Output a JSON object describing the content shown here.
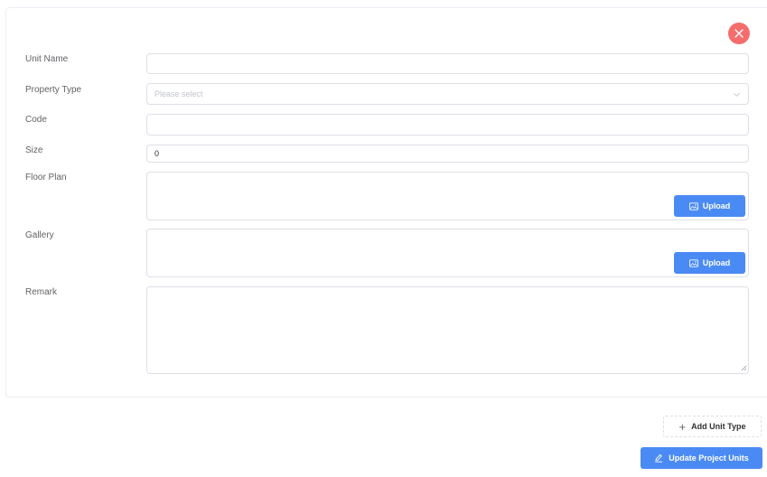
{
  "form": {
    "unit_name": {
      "label": "Unit Name",
      "value": ""
    },
    "property_type": {
      "label": "Property Type",
      "placeholder": "Please select"
    },
    "code": {
      "label": "Code",
      "value": ""
    },
    "size": {
      "label": "Size",
      "value": "0"
    },
    "floor_plan": {
      "label": "Floor Plan",
      "upload_label": "Upload"
    },
    "gallery": {
      "label": "Gallery",
      "upload_label": "Upload"
    },
    "remark": {
      "label": "Remark",
      "value": ""
    }
  },
  "actions": {
    "close_icon": "close-icon",
    "add_unit_type_label": "Add Unit Type",
    "update_project_units_label": "Update Project Units"
  },
  "colors": {
    "primary": "#4a8af4",
    "danger": "#f56c6c",
    "border": "#dcdfe6"
  }
}
